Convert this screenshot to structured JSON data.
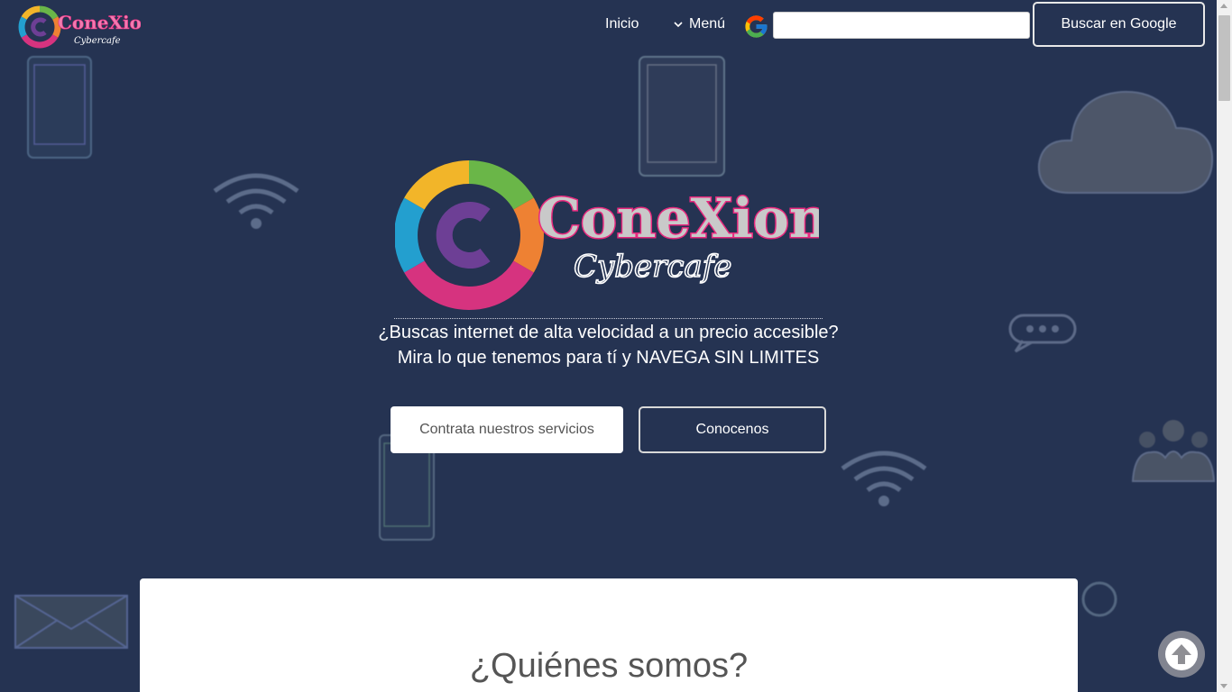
{
  "nav": {
    "inicio": "Inicio",
    "menu": "Menú",
    "search_placeholder": "",
    "google_button": "Buscar en Google"
  },
  "brand": {
    "name": "ConeXion",
    "sub": "Cybercafe"
  },
  "hero": {
    "line1": "¿Buscas internet de alta velocidad a un precio accesible?",
    "line2": "Mira lo que tenemos para tí y NAVEGA SIN LIMITES",
    "cta_primary": "Contrata nuestros servicios",
    "cta_secondary": "Conocenos"
  },
  "about": {
    "title": "¿Quiénes somos?"
  },
  "colors": {
    "background": "#253352",
    "brand_pink": "#e8297e",
    "ring_green": "#6ab648",
    "ring_yellow": "#f2b529",
    "ring_orange": "#ee8133",
    "ring_magenta": "#d6337f",
    "ring_blue": "#239fcf",
    "ring_purple": "#6d3f95"
  },
  "icons": [
    "phone-icon",
    "tablet-icon",
    "wifi-icon",
    "cloud-icon",
    "chat-bubble-icon",
    "users-icon",
    "mail-icon",
    "google-icon",
    "chevron-down-icon",
    "arrow-up-icon"
  ]
}
